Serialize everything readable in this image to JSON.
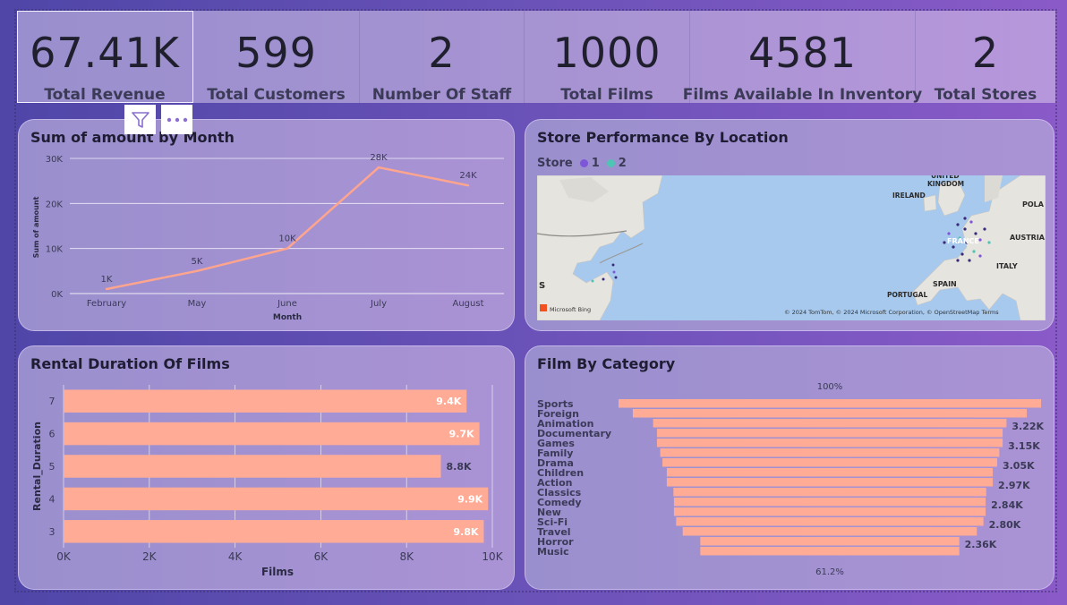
{
  "kpis": [
    {
      "value": "67.41K",
      "label": "Total Revenue"
    },
    {
      "value": "599",
      "label": "Total Customers"
    },
    {
      "value": "2",
      "label": "Number Of Staff"
    },
    {
      "value": "1000",
      "label": "Total Films"
    },
    {
      "value": "4581",
      "label": "Films Available In Inventory"
    },
    {
      "value": "2",
      "label": "Total Stores"
    }
  ],
  "icons": {
    "filter": "filter-icon",
    "more": "more-options-icon"
  },
  "colors": {
    "bar": "#ffab96",
    "line": "#ffa58e",
    "store1": "#7e56d8",
    "store2": "#4fc3b4",
    "map_water": "#a7c9ee",
    "map_land": "#e6e4df"
  },
  "line_chart": {
    "title": "Sum of amount by Month",
    "chart_data": {
      "type": "line",
      "categories": [
        "February",
        "May",
        "June",
        "July",
        "August"
      ],
      "values": [
        1,
        5,
        10,
        28,
        24
      ],
      "data_labels": [
        "1K",
        "5K",
        "10K",
        "28K",
        "24K"
      ],
      "yticks": [
        "0K",
        "10K",
        "20K",
        "30K"
      ],
      "xlabel": "Month",
      "ylabel": "Sum of amount",
      "ylim": [
        0,
        30
      ]
    }
  },
  "map_card": {
    "title": "Store Performance By Location",
    "legend_title": "Store",
    "legend_items": [
      "1",
      "2"
    ],
    "labels": {
      "uk": "UNITED\nKINGDOM",
      "ireland": "IRELAND",
      "france": "FRANCE",
      "austria": "AUSTRIA",
      "pola": "POLA",
      "spain": "SPAIN",
      "portugal": "PORTUGAL",
      "italy": "ITALY",
      "s": "S"
    },
    "attribution": "© 2024 TomTom, © 2024 Microsoft Corporation, © OpenStreetMap  Terms",
    "bing": "Microsoft Bing"
  },
  "bar_chart": {
    "title": "Rental Duration Of Films",
    "chart_data": {
      "type": "bar",
      "orientation": "horizontal",
      "categories": [
        "7",
        "6",
        "5",
        "4",
        "3"
      ],
      "values": [
        9.4,
        9.7,
        8.8,
        9.9,
        9.8
      ],
      "data_labels": [
        "9.4K",
        "9.7K",
        "8.8K",
        "9.9K",
        "9.8K"
      ],
      "xticks": [
        "0K",
        "2K",
        "4K",
        "6K",
        "8K",
        "10K"
      ],
      "xlabel": "Films",
      "ylabel": "Rental_Duration",
      "xlim": [
        0,
        10
      ]
    }
  },
  "funnel": {
    "title": "Film By Category",
    "top_label": "100%",
    "bottom_label": "61.2%",
    "chart_data": {
      "type": "bar",
      "subtype": "funnel",
      "categories": [
        "Sports",
        "Foreign",
        "Animation",
        "Documentary",
        "Games",
        "Family",
        "Drama",
        "Children",
        "Action",
        "Classics",
        "Comedy",
        "New",
        "Sci-Fi",
        "Travel",
        "Horror",
        "Music"
      ],
      "values": [
        3.85,
        3.59,
        3.22,
        3.15,
        3.15,
        3.09,
        3.05,
        2.97,
        2.97,
        2.85,
        2.84,
        2.84,
        2.8,
        2.68,
        2.36,
        2.36
      ],
      "data_labels": [
        "",
        "",
        "3.22K",
        "",
        "3.15K",
        "",
        "3.05K",
        "",
        "2.97K",
        "",
        "2.84K",
        "",
        "2.80K",
        "",
        "2.36K",
        ""
      ]
    }
  }
}
